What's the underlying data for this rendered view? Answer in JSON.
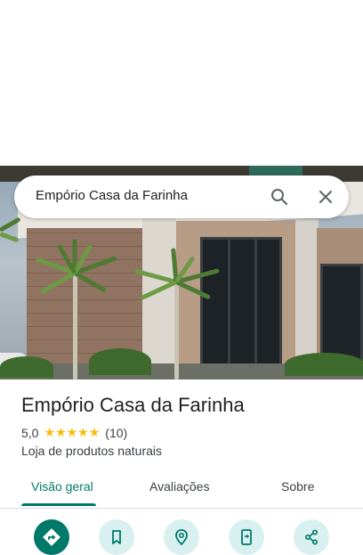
{
  "search": {
    "query": "Empório Casa da Farinha"
  },
  "place": {
    "name": "Empório Casa da Farinha",
    "rating": "5,0",
    "stars": [
      "★",
      "★",
      "★",
      "★",
      "★"
    ],
    "review_count": "(10)",
    "category": "Loja de produtos naturais"
  },
  "tabs": [
    {
      "label": "Visão geral",
      "active": true
    },
    {
      "label": "Avaliações",
      "active": false
    },
    {
      "label": "Sobre",
      "active": false
    }
  ],
  "actions": [
    {
      "icon": "directions-icon"
    },
    {
      "icon": "bookmark-icon"
    },
    {
      "icon": "nearby-icon"
    },
    {
      "icon": "send-to-phone-icon"
    },
    {
      "icon": "share-icon"
    }
  ],
  "colors": {
    "accent": "#00796b",
    "accent_light": "#d8f0ef",
    "star": "#fbbc04",
    "text": "#202124"
  }
}
